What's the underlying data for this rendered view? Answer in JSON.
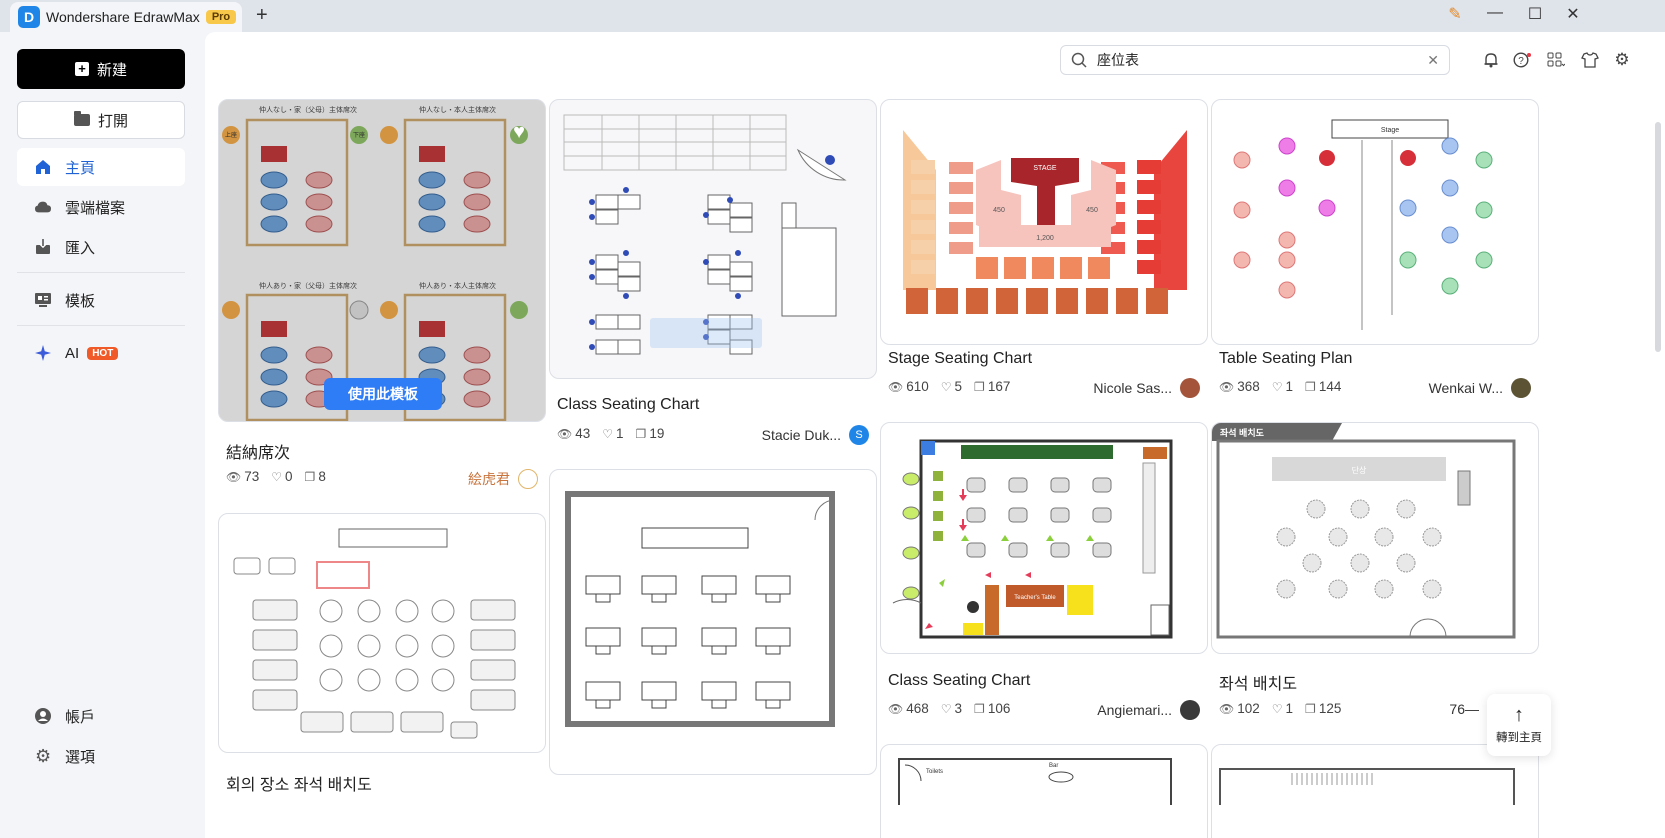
{
  "titlebar": {
    "app_logo": "D",
    "app_name": "Wondershare EdrawMax",
    "pro_badge": "Pro",
    "new_tab": "+",
    "controls": {
      "minimize": "—",
      "maximize": "☐",
      "close": "✕"
    }
  },
  "sidebar": {
    "new_label": "新建",
    "open_label": "打開",
    "items": [
      {
        "label": "主頁",
        "icon": "home-icon",
        "active": true
      },
      {
        "label": "雲端檔案",
        "icon": "cloud-icon"
      },
      {
        "label": "匯入",
        "icon": "import-icon"
      },
      {
        "label": "模板",
        "icon": "template-icon"
      },
      {
        "label": "AI",
        "icon": "sparkle-icon",
        "badge": "HOT"
      }
    ],
    "bottom": [
      {
        "label": "帳戶",
        "icon": "account-icon"
      },
      {
        "label": "選項",
        "icon": "settings-icon"
      }
    ]
  },
  "header": {
    "search_value": "座位表",
    "icons": [
      "bell-icon",
      "help-icon",
      "apps-icon",
      "shirt-icon",
      "gear-icon"
    ]
  },
  "cards": [
    {
      "title": "結納席次",
      "views": "73",
      "likes": "0",
      "copies": "8",
      "author": "絵虎君",
      "use_label": "使用此模板",
      "thumb_labels": [
        "仲人なし・家（父母）主体席次",
        "仲人なし・本人主体席次",
        "仲人あり・家（父母）主体席次",
        "仲人あり・本人主体席次",
        "上座",
        "下座"
      ]
    },
    {
      "title": "Class Seating Chart",
      "views": "43",
      "likes": "1",
      "copies": "19",
      "author": "Stacie Duk...",
      "avatar_letter": "S"
    },
    {
      "title": "Stage Seating Chart",
      "views": "610",
      "likes": "5",
      "copies": "167",
      "author": "Nicole Sas...",
      "thumb_labels": [
        "STAGE",
        "450",
        "450",
        "1,200"
      ]
    },
    {
      "title": "Table Seating Plan",
      "views": "368",
      "likes": "1",
      "copies": "144",
      "author": "Wenkai W...",
      "thumb_labels": [
        "Stage"
      ]
    },
    {
      "title": "회의 장소 좌석 배치도"
    },
    {
      "title": ""
    },
    {
      "title": "Class Seating Chart",
      "views": "468",
      "likes": "3",
      "copies": "106",
      "author": "Angiemari...",
      "thumb_labels": [
        "Teacher's Table"
      ]
    },
    {
      "title": "좌석 배치도",
      "views": "102",
      "likes": "1",
      "copies": "125",
      "author": "76—",
      "thumb_labels": [
        "좌석 배치도",
        "단상"
      ]
    }
  ],
  "bottom_peeks": [
    "Toilets",
    "Bar"
  ],
  "back_to_top": "轉到主頁",
  "colors": {
    "accent": "#1f63d6",
    "primary_button": "#000000",
    "use_button": "#2f7df6",
    "hot_badge": "#f05a28",
    "pro_badge": "#f7c84a"
  }
}
